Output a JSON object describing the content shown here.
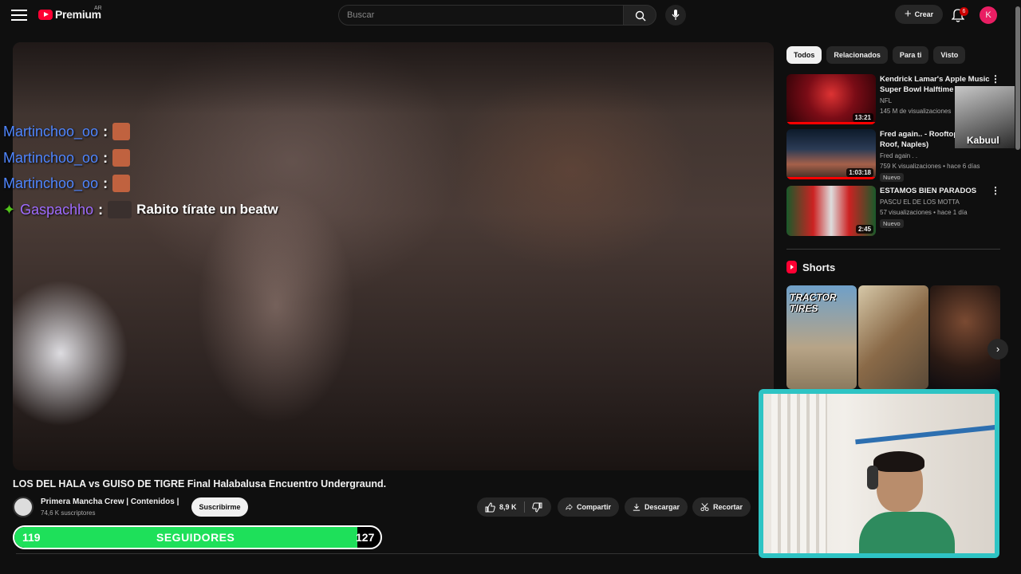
{
  "header": {
    "brand": "Premium",
    "country": "AR",
    "search_placeholder": "Buscar",
    "create_label": "Crear",
    "notifications": "6",
    "avatar_letter": "K"
  },
  "overlay_chat": [
    {
      "user": "Martinchoo_oo",
      "colon": ":",
      "message": ""
    },
    {
      "user": "Martinchoo_oo",
      "colon": ":",
      "message": ""
    },
    {
      "user": "Martinchoo_oo",
      "colon": ":",
      "message": ""
    },
    {
      "user": "Gaspachho",
      "colon": ":",
      "message": "Rabito tírate un beatw"
    }
  ],
  "video": {
    "title": "LOS DEL HALA vs GUISO DE TIGRE Final Halabalusa Encuentro Undergraund.",
    "channel": "Primera Mancha Crew | Contenidos |",
    "subscribers": "74,6 K suscriptores",
    "subscribe_label": "Suscribirme",
    "likes": "8,9 K",
    "share_label": "Compartir",
    "download_label": "Descargar",
    "clip_label": "Recortar"
  },
  "follower_goal": {
    "current": "119",
    "label": "SEGUIDORES",
    "goal": "127",
    "progress": 0.937
  },
  "filter_chips": [
    "Todos",
    "Relacionados",
    "Para ti",
    "Visto"
  ],
  "recommendations": [
    {
      "title": "Kendrick Lamar's Apple Music Super Bowl Halftime Sh...",
      "channel": "NFL",
      "stats": "145 M de visualizaciones",
      "duration": "13:21",
      "new": ""
    },
    {
      "title": "Fred again.. - Rooftop (Fede's Roof, Naples)",
      "channel": "Fred again . .",
      "stats": "759 K visualizaciones • hace 6 días",
      "duration": "1:03:18",
      "new": "Nuevo"
    },
    {
      "title": "ESTAMOS BIEN PARADOS",
      "channel": "PASCU EL DE LOS MOTTA",
      "stats": "57 visualizaciones • hace 1 día",
      "duration": "2:45",
      "new": "Nuevo"
    }
  ],
  "shorts": {
    "heading": "Shorts",
    "items": [
      {
        "label": "TRACTOR TIRES"
      },
      {
        "label": ""
      },
      {
        "label": ""
      }
    ]
  },
  "mini_overlay": {
    "name": "Kabuul"
  },
  "colors": {
    "accent": "#ff0033",
    "goal_fill": "#1ee05a",
    "cam_border": "#2ec4c4"
  }
}
